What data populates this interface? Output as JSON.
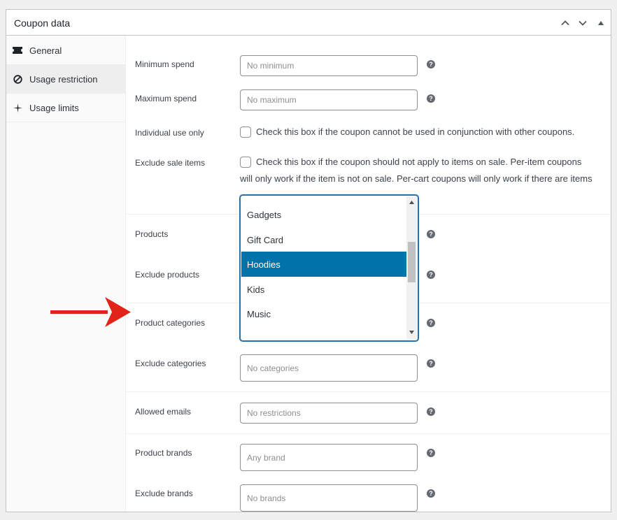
{
  "panel": {
    "title": "Coupon data",
    "controls": [
      "chevron-up-icon",
      "chevron-down-icon",
      "triangle-up-icon"
    ]
  },
  "sidebar": {
    "items": [
      {
        "label": "General",
        "icon": "ticket-icon",
        "active": false
      },
      {
        "label": "Usage restriction",
        "icon": "block-icon",
        "active": true
      },
      {
        "label": "Usage limits",
        "icon": "sparkle-icon",
        "active": false
      }
    ]
  },
  "fields": {
    "minimum_spend": {
      "label": "Minimum spend",
      "placeholder": "No minimum"
    },
    "maximum_spend": {
      "label": "Maximum spend",
      "placeholder": "No maximum"
    },
    "individual_use": {
      "label": "Individual use only",
      "text": "Check this box if the coupon cannot be used in conjunction with other coupons."
    },
    "exclude_sale": {
      "label": "Exclude sale items",
      "text_line1": "Check this box if the coupon should not apply to items on sale. Per-item coupons",
      "text_line2": "will only work if the item is not on sale. Per-cart coupons will only work if there are items"
    },
    "products": {
      "label": "Products"
    },
    "exclude_products": {
      "label": "Exclude products"
    },
    "product_categories": {
      "label": "Product categories"
    },
    "exclude_categories": {
      "label": "Exclude categories",
      "placeholder": "No categories"
    },
    "allowed_emails": {
      "label": "Allowed emails",
      "placeholder": "No restrictions"
    },
    "product_brands": {
      "label": "Product brands",
      "placeholder": "Any brand"
    },
    "exclude_brands": {
      "label": "Exclude brands",
      "placeholder": "No brands"
    }
  },
  "category_dropdown": {
    "options": [
      "Gadgets",
      "Gift Card",
      "Hoodies",
      "Kids",
      "Music"
    ],
    "selected": "Hoodies"
  },
  "help_icon_glyph": "?",
  "colors": {
    "accent": "#0073aa",
    "arrow": "#e2231a"
  }
}
